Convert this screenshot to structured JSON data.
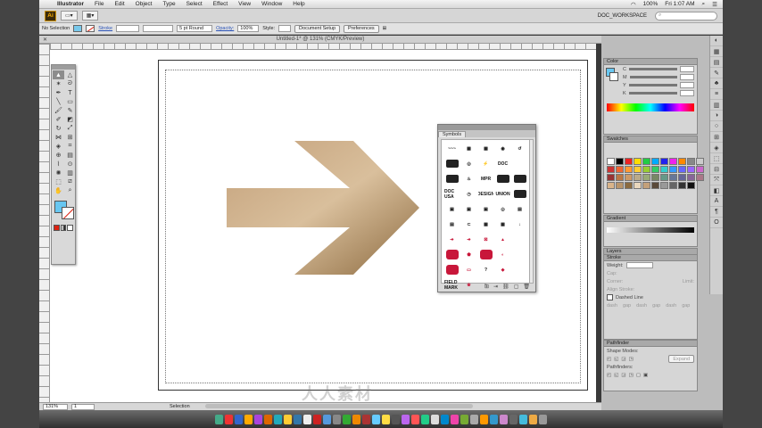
{
  "menubar": {
    "app": "Illustrator",
    "items": [
      "File",
      "Edit",
      "Object",
      "Type",
      "Select",
      "Effect",
      "View",
      "Window",
      "Help"
    ],
    "status": {
      "battery": "100%",
      "clock": "Fri 1:07 AM"
    }
  },
  "appbar": {
    "app_icon": "Ai",
    "workspace": "DOC_WORKSPACE"
  },
  "control": {
    "selection": "No Selection",
    "stroke_label": "Stroke",
    "stroke_value": "",
    "profile": "5 pt Round",
    "opacity_label": "Opacity:",
    "opacity_value": "100%",
    "style_label": "Style:",
    "doc_setup": "Document Setup",
    "preferences": "Preferences"
  },
  "doc": {
    "title": "Untitled-1* @ 131% (CMYK/Preview)"
  },
  "artwork": {
    "fill_start": "#c3a07a",
    "fill_end": "#8c6a3f",
    "fill_mid": "#d9bf9c"
  },
  "watermark": "人人素材",
  "symbols": {
    "tab": "Symbols",
    "items": [
      {
        "t": "~~~",
        "c": ""
      },
      {
        "t": "▦",
        "c": ""
      },
      {
        "t": "▦",
        "c": ""
      },
      {
        "t": "◉",
        "c": ""
      },
      {
        "t": "↺",
        "c": ""
      },
      {
        "t": "▬",
        "c": "blk"
      },
      {
        "t": "◎",
        "c": ""
      },
      {
        "t": "⚡",
        "c": ""
      },
      {
        "t": "DOC",
        "c": ""
      },
      {
        "t": "",
        "c": ""
      },
      {
        "t": "▬",
        "c": "blk"
      },
      {
        "t": "♨",
        "c": ""
      },
      {
        "t": "MPR",
        "c": ""
      },
      {
        "t": "▬",
        "c": "blk"
      },
      {
        "t": "▬",
        "c": "blk"
      },
      {
        "t": "DOC USA",
        "c": ""
      },
      {
        "t": "◷",
        "c": ""
      },
      {
        "t": "DESIGN",
        "c": ""
      },
      {
        "t": "UNION",
        "c": ""
      },
      {
        "t": "▬",
        "c": "blk"
      },
      {
        "t": "▣",
        "c": ""
      },
      {
        "t": "▣",
        "c": ""
      },
      {
        "t": "▣",
        "c": ""
      },
      {
        "t": "◎",
        "c": ""
      },
      {
        "t": "▤",
        "c": ""
      },
      {
        "t": "▤",
        "c": ""
      },
      {
        "t": "⊂",
        "c": ""
      },
      {
        "t": "▦",
        "c": ""
      },
      {
        "t": "▦",
        "c": ""
      },
      {
        "t": "↓",
        "c": ""
      },
      {
        "t": "➔",
        "c": "red"
      },
      {
        "t": "➔",
        "c": "red"
      },
      {
        "t": "⊠",
        "c": "red"
      },
      {
        "t": "▲",
        "c": "red"
      },
      {
        "t": "",
        "c": ""
      },
      {
        "t": "●",
        "c": "rblk"
      },
      {
        "t": "⬟",
        "c": "red"
      },
      {
        "t": "●",
        "c": "rblk"
      },
      {
        "t": "◐",
        "c": "red"
      },
      {
        "t": "",
        "c": ""
      },
      {
        "t": "●",
        "c": "rblk"
      },
      {
        "t": "▭",
        "c": "red"
      },
      {
        "t": "?",
        "c": ""
      },
      {
        "t": "◆",
        "c": "red"
      },
      {
        "t": "",
        "c": ""
      },
      {
        "t": "FIELD MARK",
        "c": ""
      },
      {
        "t": "❀",
        "c": "red"
      },
      {
        "t": "~",
        "c": ""
      },
      {
        "t": "",
        "c": ""
      },
      {
        "t": "",
        "c": ""
      }
    ]
  },
  "tools": [
    {
      "n": "selection-tool",
      "g": "▲",
      "sel": true
    },
    {
      "n": "direct-selection-tool",
      "g": "△"
    },
    {
      "n": "magic-wand-tool",
      "g": "✶"
    },
    {
      "n": "lasso-tool",
      "g": "ᘐ"
    },
    {
      "n": "pen-tool",
      "g": "✒"
    },
    {
      "n": "type-tool",
      "g": "T"
    },
    {
      "n": "line-tool",
      "g": "╲"
    },
    {
      "n": "rectangle-tool",
      "g": "▭"
    },
    {
      "n": "paintbrush-tool",
      "g": "🖌"
    },
    {
      "n": "pencil-tool",
      "g": "✎"
    },
    {
      "n": "blob-brush-tool",
      "g": "✐"
    },
    {
      "n": "eraser-tool",
      "g": "◩"
    },
    {
      "n": "rotate-tool",
      "g": "↻"
    },
    {
      "n": "scale-tool",
      "g": "⤢"
    },
    {
      "n": "width-tool",
      "g": "⋈"
    },
    {
      "n": "free-transform-tool",
      "g": "⊞"
    },
    {
      "n": "shape-builder-tool",
      "g": "◈"
    },
    {
      "n": "perspective-tool",
      "g": "⌗"
    },
    {
      "n": "mesh-tool",
      "g": "⊕"
    },
    {
      "n": "gradient-tool",
      "g": "▤"
    },
    {
      "n": "eyedropper-tool",
      "g": "⌇"
    },
    {
      "n": "blend-tool",
      "g": "⊙"
    },
    {
      "n": "symbol-sprayer-tool",
      "g": "✺"
    },
    {
      "n": "graph-tool",
      "g": "▥"
    },
    {
      "n": "artboard-tool",
      "g": "⬚"
    },
    {
      "n": "slice-tool",
      "g": "⧄"
    },
    {
      "n": "hand-tool",
      "g": "✋"
    },
    {
      "n": "zoom-tool",
      "g": "⌕"
    }
  ],
  "panels": {
    "color": "Color",
    "color_rows": [
      "C",
      "M",
      "Y",
      "K"
    ],
    "swatches": "Swatches",
    "gradient": "Gradient",
    "layers": "Layers",
    "stroke": "Stroke",
    "weight_label": "Weight:",
    "cap_label": "Cap:",
    "corner_label": "Corner:",
    "limit_label": "Limit:",
    "align_label": "Align Stroke:",
    "dashed": "Dashed Line",
    "dash_labels": [
      "dash",
      "gap",
      "dash",
      "gap",
      "dash",
      "gap"
    ],
    "pathfinder": "Pathfinder",
    "shape_modes": "Shape Modes:",
    "expand": "Expand",
    "pathfinders": "Pathfinders:"
  },
  "statusbar": {
    "zoom": "131%",
    "page": "1",
    "tool": "Selection"
  }
}
